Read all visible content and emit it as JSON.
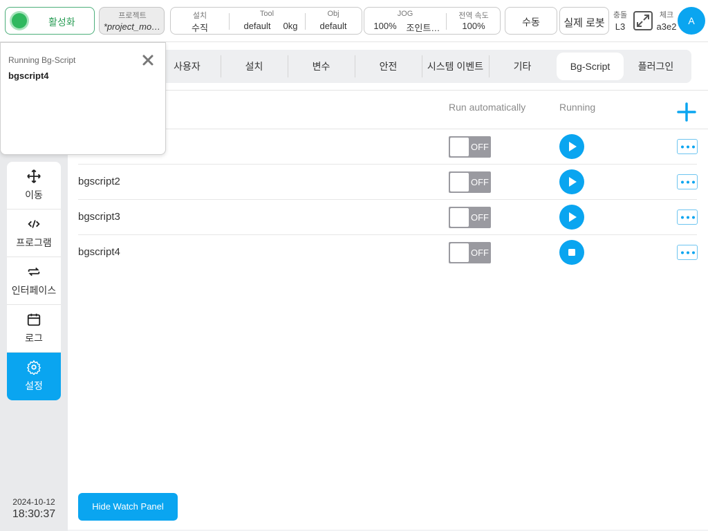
{
  "topbar": {
    "activate_label": "활성화",
    "project": {
      "caption": "프로젝트",
      "value": "*project_mo…"
    },
    "install": {
      "caption": "설치",
      "value": "수직"
    },
    "tool": {
      "caption": "Tool",
      "name": "default",
      "weight": "0kg"
    },
    "obj": {
      "caption": "Obj",
      "value": "default"
    },
    "jog": {
      "caption": "JOG",
      "percent": "100%",
      "mode": "조인트…"
    },
    "global_speed": {
      "caption": "전역 속도",
      "value": "100%"
    },
    "manual_label": "수동",
    "real_robot_label": "실제 로봇",
    "collision": {
      "caption": "충돌",
      "value": "L3"
    },
    "check": {
      "caption": "체크",
      "value": "a3e2"
    },
    "avatar_letter": "A"
  },
  "sidebar": {
    "items": [
      {
        "label": "이동",
        "icon": "move-arrows-icon"
      },
      {
        "label": "프로그램",
        "icon": "code-icon"
      },
      {
        "label": "인터페이스",
        "icon": "swap-arrows-icon"
      },
      {
        "label": "로그",
        "icon": "calendar-icon"
      },
      {
        "label": "설정",
        "icon": "gear-icon",
        "active": true
      }
    ],
    "date": "2024-10-12",
    "time": "18:30:37"
  },
  "tabs": [
    {
      "label": "사용자"
    },
    {
      "label": "설치"
    },
    {
      "label": "변수"
    },
    {
      "label": "안전"
    },
    {
      "label": "시스템 이벤트"
    },
    {
      "label": "기타"
    },
    {
      "label": "Bg-Script",
      "active": true
    },
    {
      "label": "플러그인"
    }
  ],
  "table": {
    "col_auto": "Run automatically",
    "col_running": "Running",
    "rows": [
      {
        "name": "bgscript2",
        "toggle": "OFF",
        "state": "play"
      },
      {
        "name": "bgscript3",
        "toggle": "OFF",
        "state": "play"
      },
      {
        "name": "bgscript4",
        "toggle": "OFF",
        "state": "stop"
      }
    ],
    "first_row_toggle": "OFF"
  },
  "hide_watch_label": "Hide Watch Panel",
  "popup": {
    "title": "Running Bg-Script",
    "value": "bgscript4"
  },
  "colors": {
    "accent": "#0aa5f0",
    "active_green": "#2fb85e",
    "toggle_off": "#9a9aa0"
  }
}
